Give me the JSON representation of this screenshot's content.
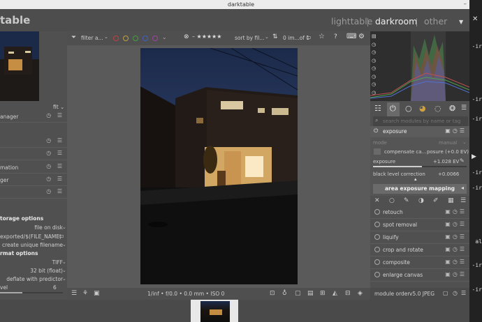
{
  "window": {
    "title": "darktable"
  },
  "header": {
    "app_name": "table",
    "views": [
      {
        "label": "lighttable",
        "active": false
      },
      {
        "label": "darkroom",
        "active": true
      },
      {
        "label": "other",
        "active": false
      }
    ]
  },
  "left_panel": {
    "zoom_label": "fit",
    "rows": [
      {
        "label": "anager"
      },
      {
        "label": ""
      },
      {
        "label": ""
      },
      {
        "label": "mation"
      },
      {
        "label": "ger"
      },
      {
        "label": ""
      }
    ],
    "storage_section": "torage options",
    "storage": {
      "target": "file on disk",
      "path": "exported/$(FILE_NAME)",
      "conflict": "create unique filename"
    },
    "format_section": "rmat options",
    "format": {
      "type": "TIFF",
      "bit_depth": "32 bit (float)",
      "compression": "deflate with predictor",
      "level_label": "vel",
      "level_value": "6"
    }
  },
  "toolbar": {
    "filter_label": "filter a...",
    "sort_label": "sort by fil...",
    "count_label": "0 im...of 1"
  },
  "bottombar": {
    "info": "1/inf • f/0.0 • 0.0 mm • ISO 0"
  },
  "right_panel": {
    "search_placeholder": "search modules by name or tag",
    "exposure": {
      "title": "exposure",
      "mode_label": "mode",
      "mode_value": "manual",
      "compensate_label": "compensate ca...",
      "compensate_value": "posure (+0.0 EV)",
      "exposure_label": "exposure",
      "exposure_value": "+1.028 EV",
      "black_label": "black level correction",
      "black_value": "+0.0066",
      "area_button": "area exposure mapping"
    },
    "modules": [
      {
        "name": "retouch"
      },
      {
        "name": "spot removal"
      },
      {
        "name": "liquify"
      },
      {
        "name": "crop and rotate"
      },
      {
        "name": "composite"
      },
      {
        "name": "enlarge canvas"
      }
    ],
    "footer": {
      "order_label": "module order",
      "order_value": "v5.0 JPEG"
    }
  },
  "side_strip": {
    "labels": [
      "-ir",
      "-ir",
      "-ir",
      "-ir",
      "-ir",
      "al",
      "-ir",
      "-ir"
    ]
  },
  "colors": {
    "accent_active": "#eeeeee",
    "panel": "#505050",
    "center": "#5a5a5a"
  }
}
